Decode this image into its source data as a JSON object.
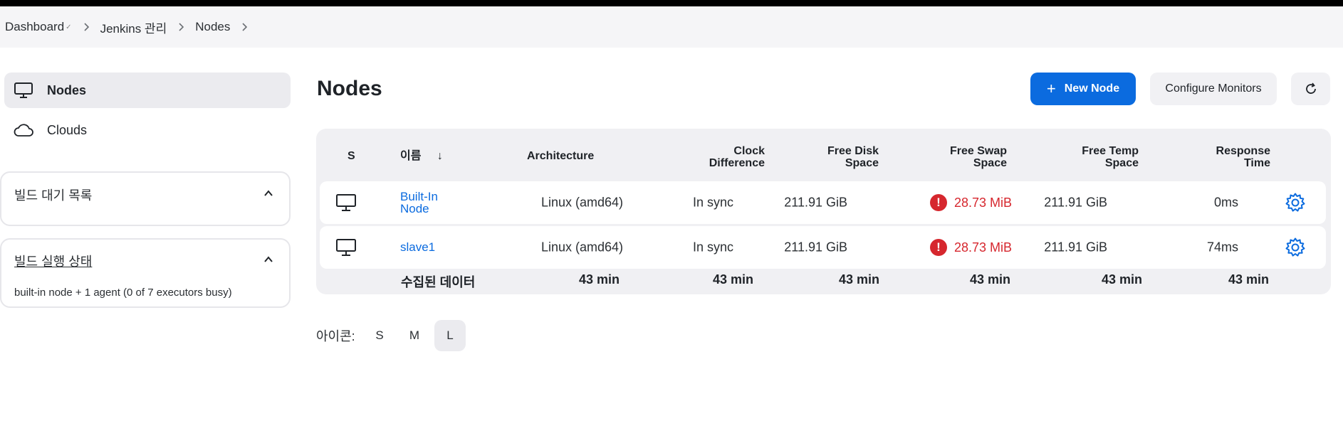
{
  "breadcrumb": {
    "items": [
      "Dashboard",
      "Jenkins 관리",
      "Nodes"
    ]
  },
  "sidebar": {
    "items": [
      {
        "label": "Nodes",
        "icon": "computer-icon",
        "active": true
      },
      {
        "label": "Clouds",
        "icon": "cloud-icon",
        "active": false
      }
    ],
    "build_queue": {
      "title": "빌드 대기 목록"
    },
    "executor_status": {
      "title": "빌드 실행 상태",
      "body": "built-in node + 1 agent (0 of 7 executors busy)"
    }
  },
  "main": {
    "title": "Nodes",
    "new_node_label": "New Node",
    "configure_monitors_label": "Configure Monitors",
    "refresh_icon": "refresh-icon"
  },
  "table": {
    "headers": {
      "s": "S",
      "name": "이름",
      "sort_arrow": "↓",
      "architecture": "Architecture",
      "clock_1": "Clock",
      "clock_2": "Difference",
      "disk_1": "Free Disk",
      "disk_2": "Space",
      "swap_1": "Free Swap",
      "swap_2": "Space",
      "temp_1": "Free Temp",
      "temp_2": "Space",
      "resp_1": "Response",
      "resp_2": "Time"
    },
    "rows": [
      {
        "name_1": "Built-In",
        "name_2": "Node",
        "architecture": "Linux (amd64)",
        "clock": "In sync",
        "disk": "211.91 GiB",
        "swap": "28.73 MiB",
        "temp": "211.91 GiB",
        "response": "0ms"
      },
      {
        "name_1": "slave1",
        "name_2": "",
        "architecture": "Linux (amd64)",
        "clock": "In sync",
        "disk": "211.91 GiB",
        "swap": "28.73 MiB",
        "temp": "211.91 GiB",
        "response": "74ms"
      }
    ],
    "summary": {
      "label": "수집된 데이터",
      "architecture": "43 min",
      "clock": "43 min",
      "disk": "43 min",
      "swap": "43 min",
      "temp": "43 min",
      "response": "43 min"
    },
    "warning_symbol": "!"
  },
  "icon_size": {
    "label": "아이콘:",
    "options": [
      "S",
      "M",
      "L"
    ],
    "selected": "L"
  },
  "colors": {
    "accent": "#0b6bdf",
    "warning": "#d6272e"
  }
}
